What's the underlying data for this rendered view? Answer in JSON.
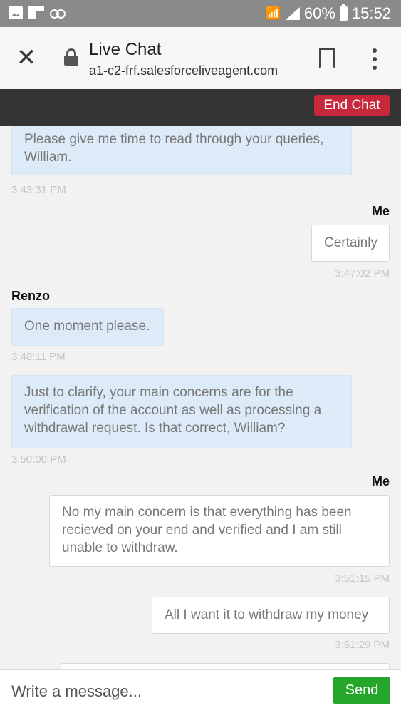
{
  "status_bar": {
    "battery": "60%",
    "time": "15:52",
    "icons": [
      "image-icon",
      "flipboard-icon",
      "voicemail-icon",
      "wifi-icon",
      "signal-icon",
      "battery-icon"
    ]
  },
  "toolbar": {
    "title": "Live Chat",
    "url": "a1-c2-frf.salesforceliveagent.com",
    "close_glyph": "✕"
  },
  "chat_header": {
    "end_chat_label": "End Chat",
    "end_chat_color": "#c8283c"
  },
  "messages": [
    {
      "sender": "",
      "type": "agent",
      "text": "Please give me time to read through your queries, William.",
      "time": "3:43:31 PM"
    },
    {
      "sender": "Me",
      "type": "me",
      "text": "Certainly",
      "time": "3:47:02 PM"
    },
    {
      "sender": "Renzo",
      "type": "agent",
      "text": "One moment please.",
      "time": "3:48:11 PM"
    },
    {
      "sender": "",
      "type": "agent",
      "text": "Just to clarify, your main concerns are for the verification of the account as well as processing a withdrawal request. Is that correct, William?",
      "time": "3:50:00 PM"
    },
    {
      "sender": "Me",
      "type": "me",
      "text": "No my main concern is that everything has been recieved on your end and verified and I am still unable to withdraw.",
      "time": "3:51:15 PM"
    },
    {
      "sender": "",
      "type": "me",
      "text": "All I want it to withdraw my money",
      "time": "3:51:29 PM"
    }
  ],
  "composer": {
    "placeholder": "Write a message...",
    "send_label": "Send",
    "send_color": "#25a52a"
  },
  "colors": {
    "agent_bubble": "#dcebf7",
    "me_bubble": "#ffffff",
    "status_bar": "#8a8a8a",
    "chat_header": "#333333"
  }
}
